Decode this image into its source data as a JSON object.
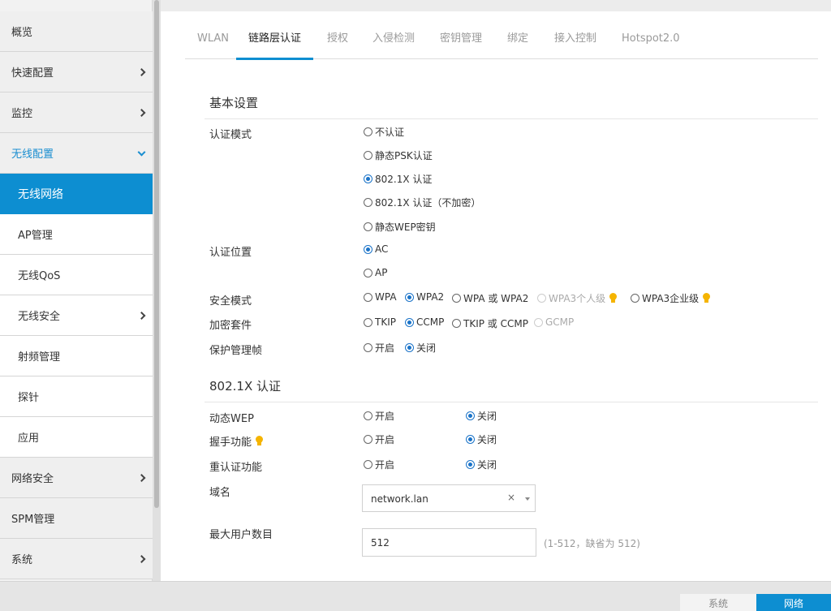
{
  "sidebar": {
    "items": [
      {
        "label": "概览"
      },
      {
        "label": "快速配置"
      },
      {
        "label": "监控"
      },
      {
        "label": "无线配置"
      },
      {
        "label": "无线网络"
      },
      {
        "label": "AP管理"
      },
      {
        "label": "无线QoS"
      },
      {
        "label": "无线安全"
      },
      {
        "label": "射频管理"
      },
      {
        "label": "探针"
      },
      {
        "label": "应用"
      },
      {
        "label": "网络安全"
      },
      {
        "label": "SPM管理"
      },
      {
        "label": "系统"
      }
    ],
    "active": "无线网络"
  },
  "tabs": [
    "WLAN",
    "链路层认证",
    "授权",
    "入侵检测",
    "密钥管理",
    "绑定",
    "接入控制",
    "Hotspot2.0"
  ],
  "active_tab": "链路层认证",
  "basic": {
    "title": "基本设置",
    "auth_mode": {
      "label": "认证模式",
      "options": [
        "不认证",
        "静态PSK认证",
        "802.1X 认证",
        "802.1X 认证（不加密）",
        "静态WEP密钥"
      ],
      "selected": "802.1X 认证"
    },
    "auth_location": {
      "label": "认证位置",
      "options": [
        "AC",
        "AP"
      ],
      "selected": "AC"
    },
    "security_mode": {
      "label": "安全模式",
      "options": [
        "WPA",
        "WPA2",
        "WPA 或 WPA2",
        "WPA3个人级",
        "WPA3企业级"
      ],
      "selected": "WPA2"
    },
    "cipher_suite": {
      "label": "加密套件",
      "options": [
        "TKIP",
        "CCMP",
        "TKIP 或 CCMP",
        "GCMP"
      ],
      "selected": "CCMP"
    },
    "pmf": {
      "label": "保护管理帧",
      "options": [
        "开启",
        "关闭"
      ],
      "selected": "关闭"
    }
  },
  "dot1x": {
    "title": "802.1X 认证",
    "dynamic_wep": {
      "label": "动态WEP",
      "on": "开启",
      "off": "关闭",
      "selected": "关闭"
    },
    "handshake": {
      "label": "握手功能",
      "on": "开启",
      "off": "关闭",
      "selected": "关闭"
    },
    "reauth": {
      "label": "重认证功能",
      "on": "开启",
      "off": "关闭",
      "selected": "关闭"
    },
    "domain": {
      "label": "域名",
      "value": "network.lan",
      "clear": "×"
    },
    "max_users": {
      "label": "最大用户数目",
      "value": "512",
      "hint": "(1-512，缺省为 512)"
    }
  },
  "bottom": {
    "tabs": [
      "系统",
      "网络"
    ],
    "active": "网络"
  },
  "colors": {
    "accent": "#0d8ed1",
    "tip": "#f5b400"
  }
}
